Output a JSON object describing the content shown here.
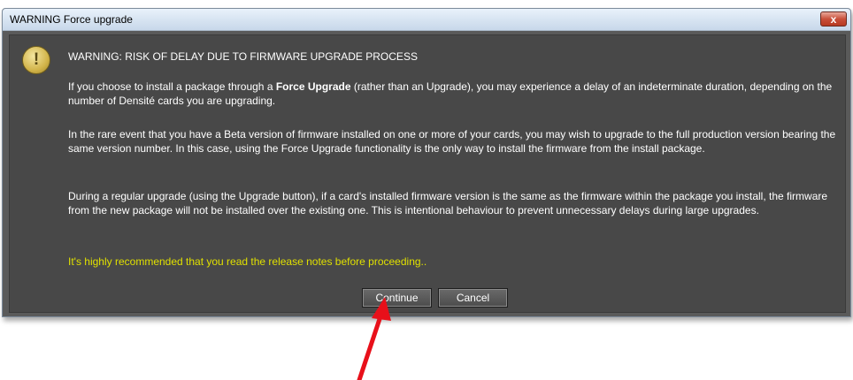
{
  "window": {
    "title": "WARNING Force upgrade",
    "close_glyph": "x"
  },
  "icon": {
    "name": "warning-icon",
    "glyph": "!"
  },
  "message": {
    "heading": "WARNING: RISK OF DELAY DUE TO FIRMWARE UPGRADE PROCESS",
    "p1_before": "If you choose to install a package through a ",
    "p1_bold": "Force Upgrade",
    "p1_after": " (rather than an Upgrade), you may experience a delay of an indeterminate duration, depending on the number of Densité cards you are upgrading.",
    "p2": "In the rare event that you have a Beta version of firmware installed on one or more of your cards, you may wish to upgrade to the full production version bearing the same version number. In this case, using the Force Upgrade functionality is the only way to install the firmware from the install package.",
    "p3": "During a regular upgrade (using the Upgrade button), if a card's installed firmware version is the same as the firmware within the package you install, the firmware from the new package will not be installed over the existing one. This is intentional behaviour to prevent unnecessary delays during large upgrades.",
    "recommendation": "It's highly recommended that you read the release notes before proceeding.."
  },
  "buttons": {
    "continue_label": "Continue",
    "cancel_label": "Cancel"
  },
  "colors": {
    "recommendation_text": "#e0e000",
    "annotation_arrow": "#e8101a"
  }
}
